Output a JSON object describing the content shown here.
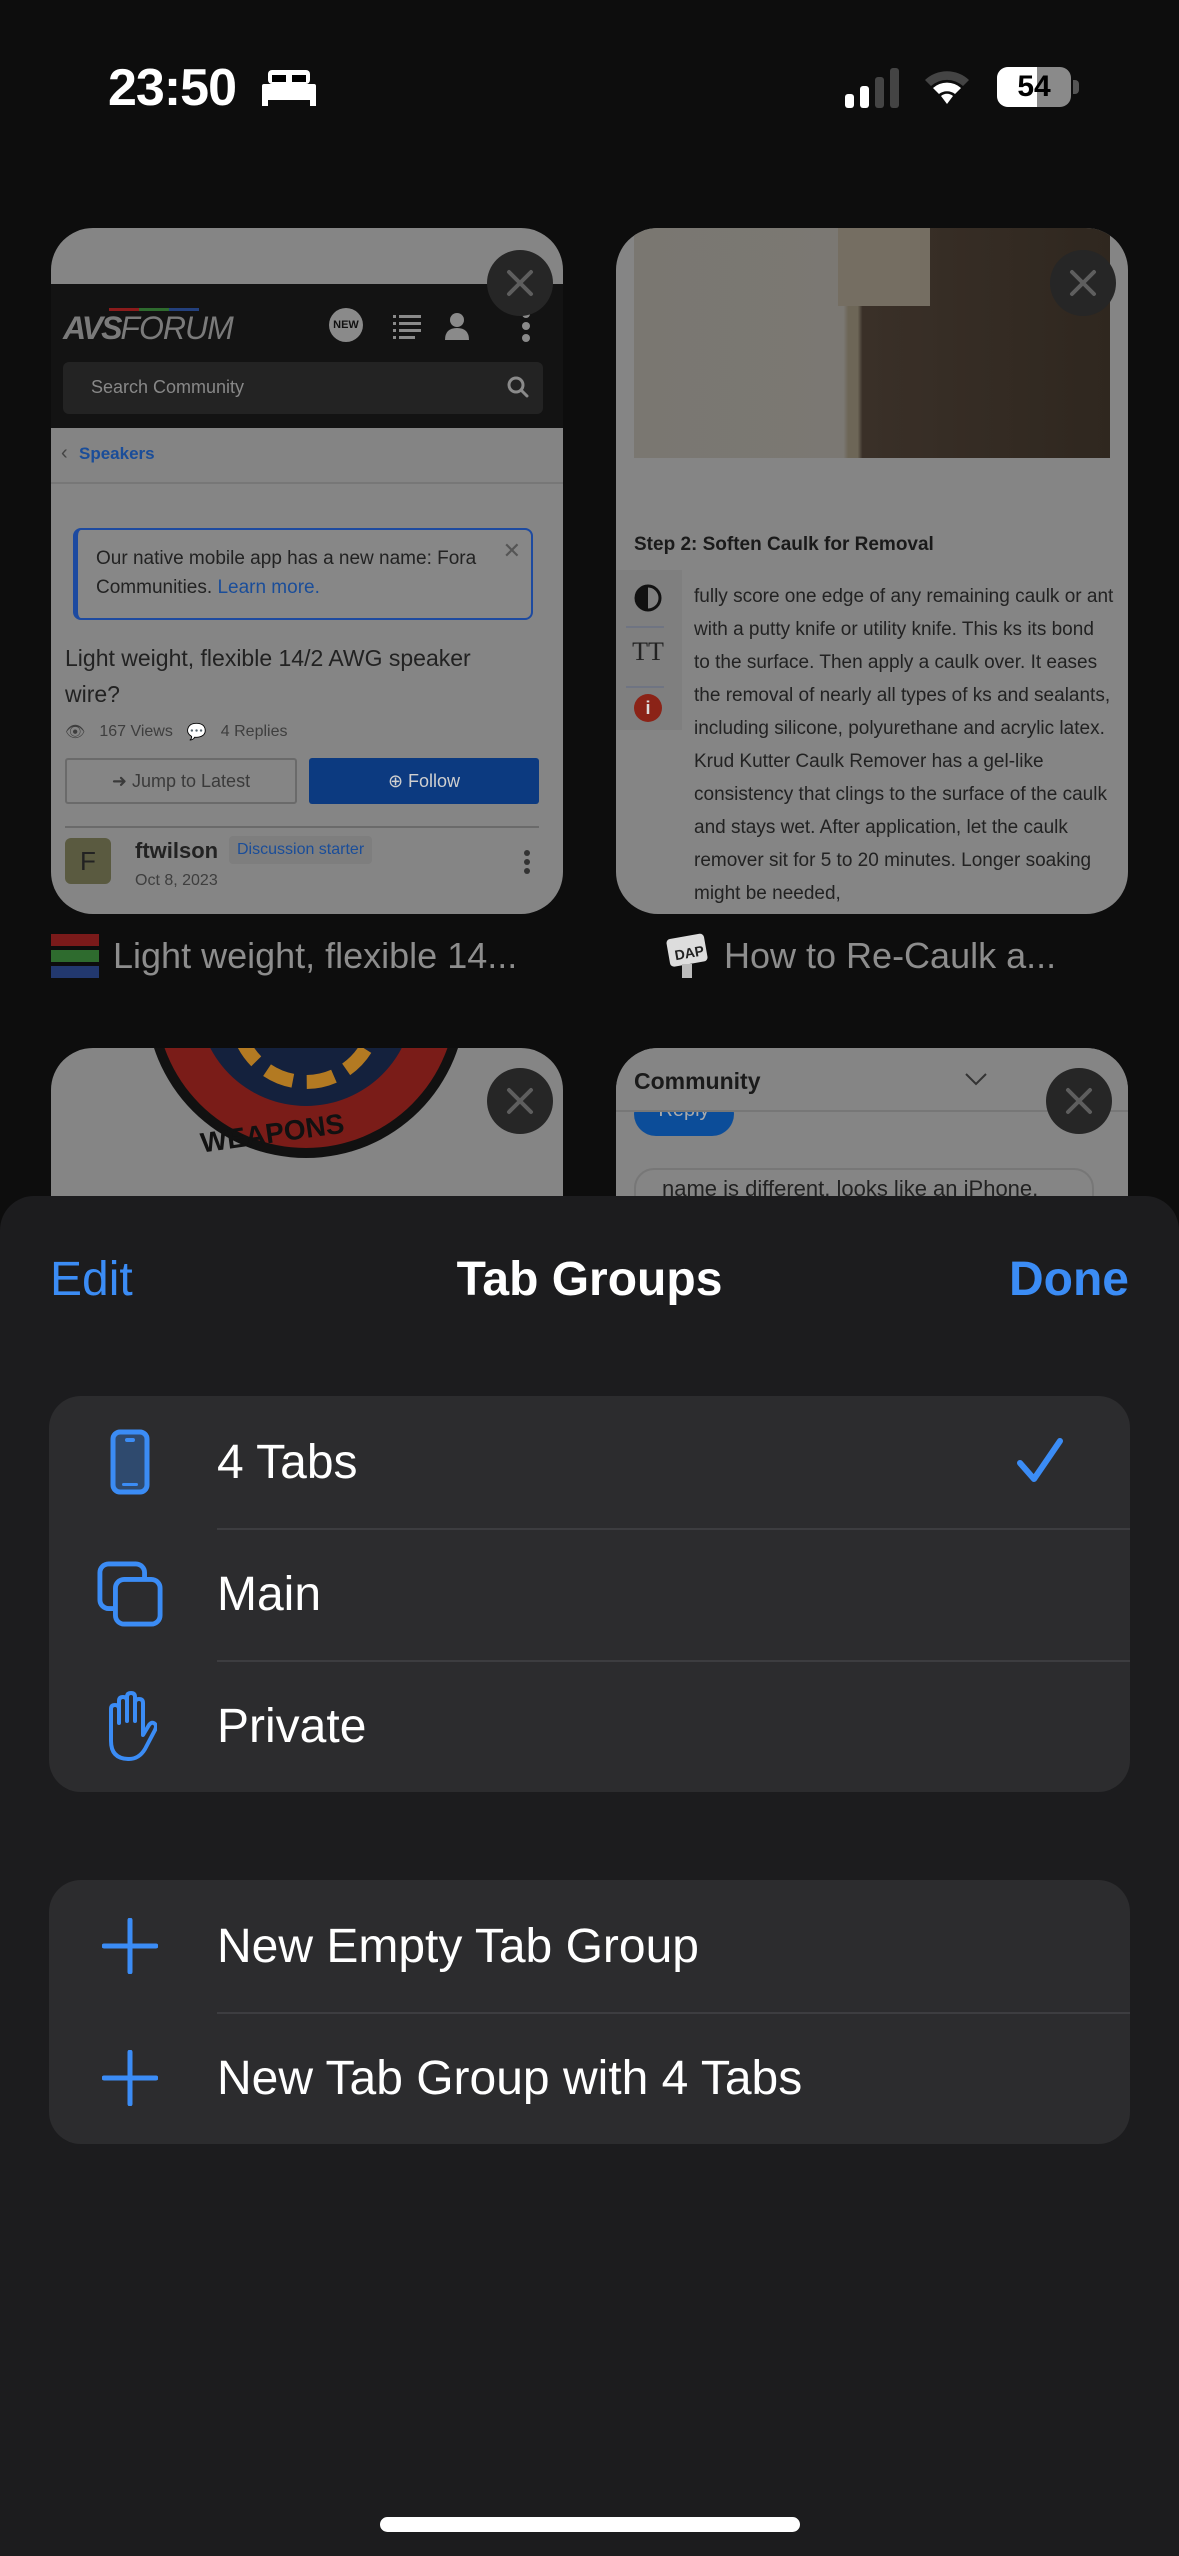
{
  "status_bar": {
    "time": "23:50",
    "focus_icon": "bed-icon",
    "signal_icon": "cellular-signal-icon",
    "wifi_icon": "wifi-icon",
    "battery_percent": "54",
    "battery_level": 0.54
  },
  "tabs": [
    {
      "title": "Light weight, flexible 14...",
      "favicon": "avs-forum-favicon",
      "preview": {
        "site_logo_bold": "AVS",
        "site_logo_light": "FORUM",
        "new_badge": "NEW",
        "search_placeholder": "Search Community",
        "breadcrumb": "Speakers",
        "notice_text": "Our native mobile app has a new name: Fora Communities.",
        "notice_link": "Learn more.",
        "thread_title": "Light weight, flexible 14/2 AWG speaker wire?",
        "views": "167 Views",
        "replies": "4 Replies",
        "jump_button": "Jump to Latest",
        "follow_button": "Follow",
        "author_initial": "F",
        "author": "ftwilson",
        "author_badge": "Discussion starter",
        "post_date": "Oct 8, 2023"
      }
    },
    {
      "title": "How to Re-Caulk a...",
      "favicon": "dap-favicon",
      "favicon_text": "DAP",
      "preview": {
        "heading": "Step 2: Soften Caulk for Removal",
        "body": "fully score one edge of any remaining caulk or ant with a putty knife or utility knife. This ks its bond to the surface. Then apply a caulk over. It eases the removal of nearly all types of ks and sealants, including silicone, polyurethane and acrylic latex. Krud Kutter Caulk Remover has a gel-like consistency that clings to the surface of the caulk and stays wet. After application, let the caulk remover sit for 5 to 20 minutes. Longer soaking might be needed,",
        "tool_contrast": "contrast-icon",
        "tool_text_size": "TT",
        "tool_info": "i"
      }
    },
    {
      "title": "",
      "preview": {
        "patch_text": "FIGHTER WEAPONS SCHOOL"
      }
    },
    {
      "title": "",
      "preview": {
        "header": "Community",
        "reply_button": "Reply",
        "comment_snippet": "name is different, looks like an iPhone,"
      }
    }
  ],
  "sheet": {
    "title": "Tab Groups",
    "edit_label": "Edit",
    "done_label": "Done",
    "accent_color": "#3b8cf5",
    "groups": [
      {
        "label": "4 Tabs",
        "icon": "iphone-icon",
        "selected": true
      },
      {
        "label": "Main",
        "icon": "square-on-square-icon",
        "selected": false
      },
      {
        "label": "Private",
        "icon": "hand-raised-icon",
        "selected": false
      }
    ],
    "actions": [
      {
        "label": "New Empty Tab Group",
        "icon": "plus-icon"
      },
      {
        "label": "New Tab Group with 4 Tabs",
        "icon": "plus-icon"
      }
    ]
  }
}
